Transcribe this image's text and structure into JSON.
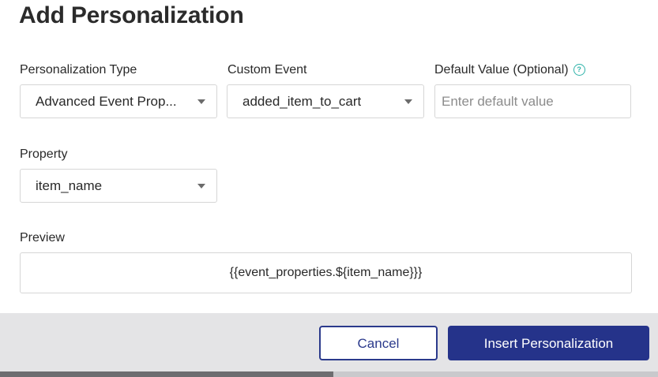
{
  "dialog": {
    "title": "Add Personalization"
  },
  "fields": {
    "personalization_type": {
      "label": "Personalization Type",
      "value": "Advanced Event Prop..."
    },
    "custom_event": {
      "label": "Custom Event",
      "value": "added_item_to_cart"
    },
    "default_value": {
      "label": "Default Value (Optional)",
      "help_icon": "?",
      "value": "",
      "placeholder": "Enter default value"
    },
    "property": {
      "label": "Property",
      "value": "item_name"
    },
    "preview": {
      "label": "Preview",
      "value": "{{event_properties.${item_name}}}"
    }
  },
  "footer": {
    "cancel_label": "Cancel",
    "insert_label": "Insert Personalization"
  },
  "colors": {
    "primary": "#25338a",
    "help_icon": "#2fb3a9",
    "footer_bg": "#e4e4e6"
  },
  "icons": {
    "dropdown": "chevron-down-icon",
    "help": "help-circle-icon"
  }
}
